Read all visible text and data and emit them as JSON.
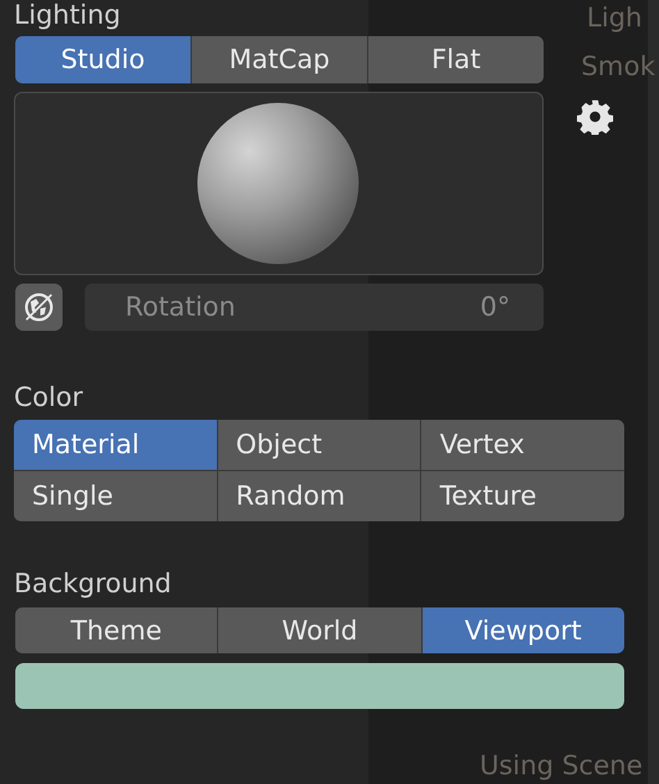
{
  "lighting": {
    "label": "Lighting",
    "modes": [
      {
        "label": "Studio",
        "selected": true
      },
      {
        "label": "MatCap",
        "selected": false
      },
      {
        "label": "Flat",
        "selected": false
      }
    ],
    "rotation": {
      "label": "Rotation",
      "value": "0°"
    }
  },
  "color": {
    "label": "Color",
    "options": [
      {
        "label": "Material",
        "selected": true
      },
      {
        "label": "Object",
        "selected": false
      },
      {
        "label": "Vertex",
        "selected": false
      },
      {
        "label": "Single",
        "selected": false
      },
      {
        "label": "Random",
        "selected": false
      },
      {
        "label": "Texture",
        "selected": false
      }
    ]
  },
  "background": {
    "label": "Background",
    "options": [
      {
        "label": "Theme",
        "selected": false
      },
      {
        "label": "World",
        "selected": false
      },
      {
        "label": "Viewport",
        "selected": true
      }
    ],
    "color": "#9cc4b4"
  },
  "behind": {
    "items": [
      "Ligh",
      "Smok",
      "Using Scene"
    ]
  }
}
